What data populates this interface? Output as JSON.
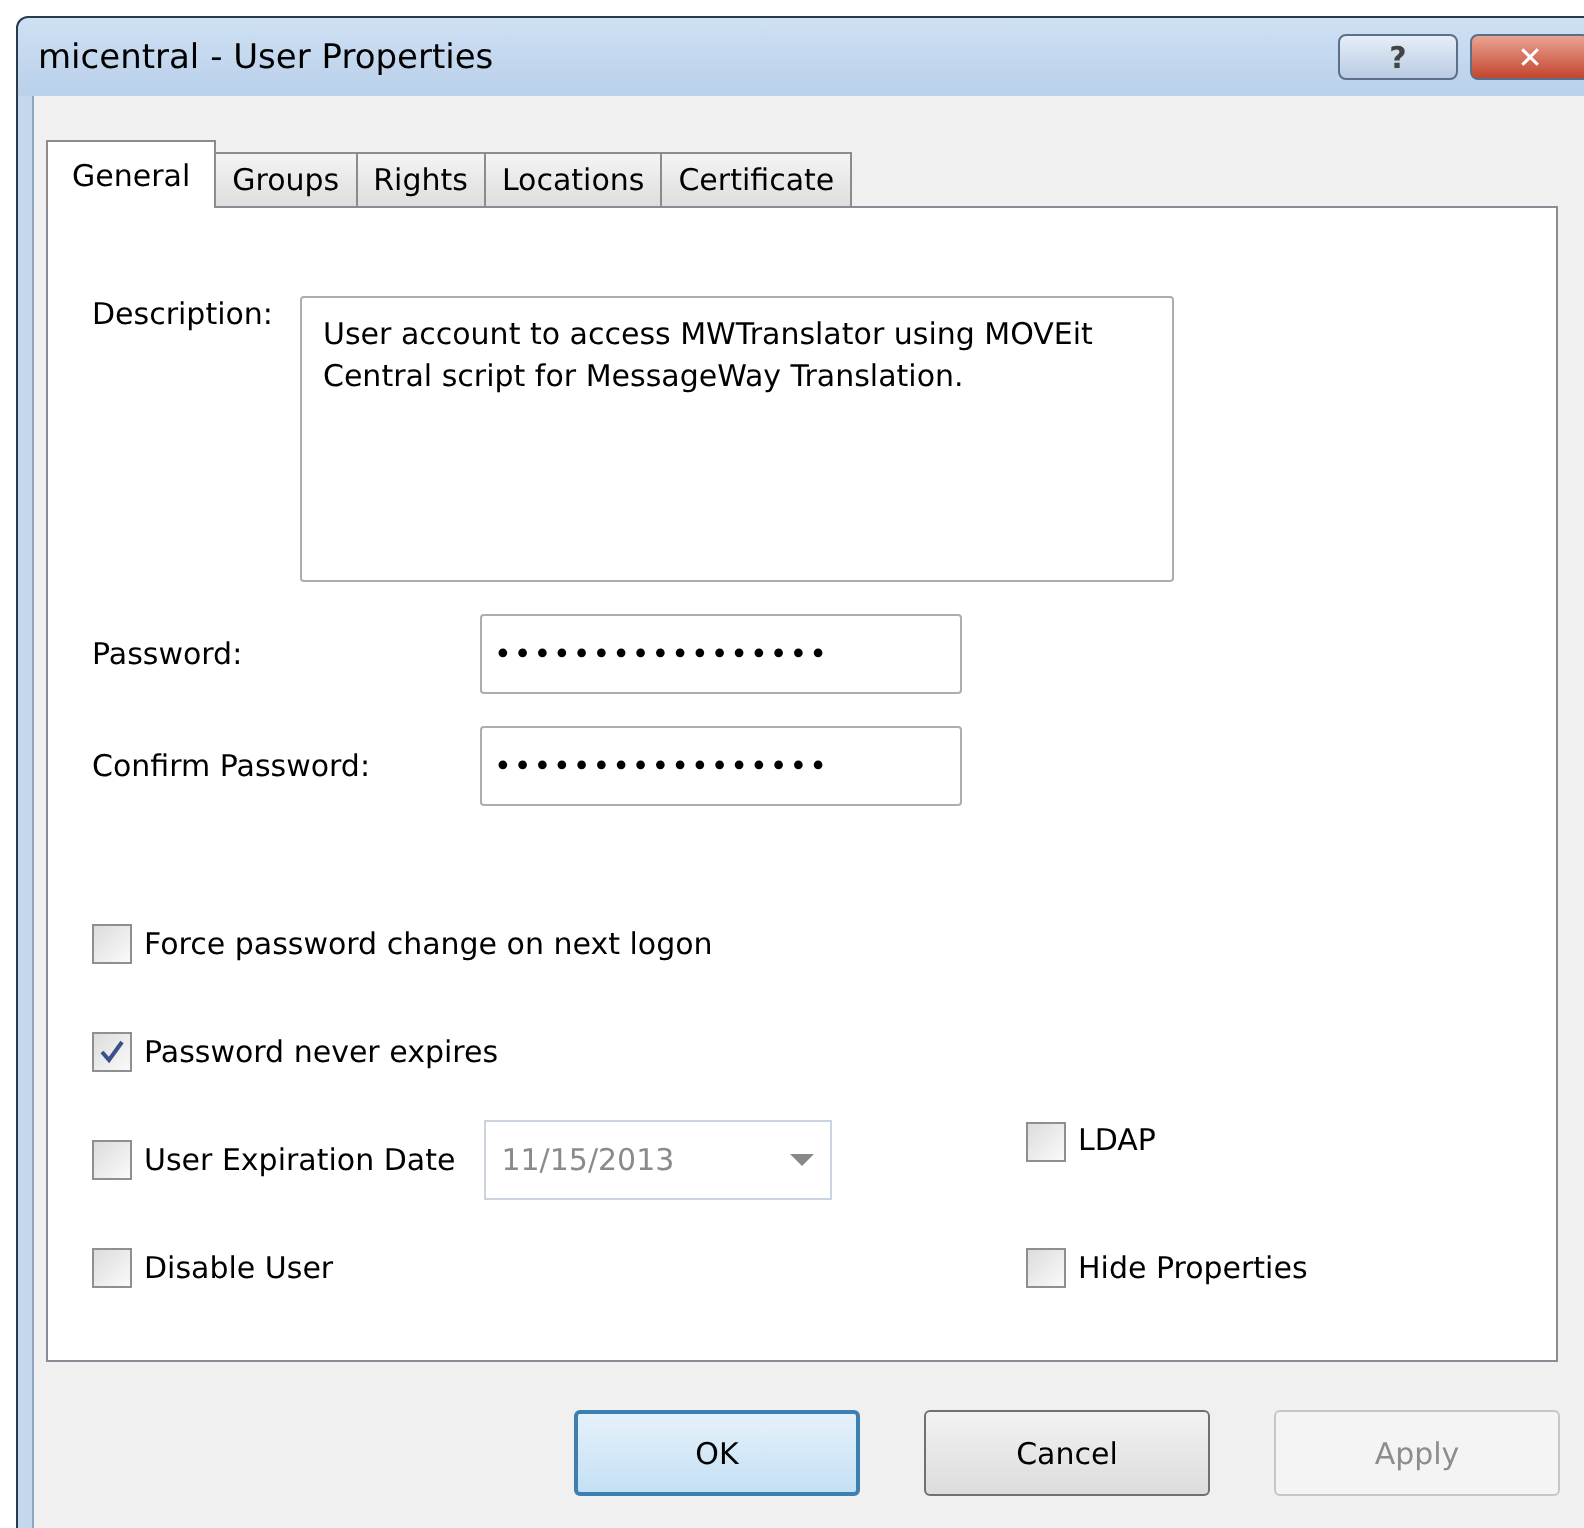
{
  "window": {
    "title": "micentral - User Properties",
    "help_button": "?",
    "close_button": "✕"
  },
  "tabs": [
    {
      "label": "General",
      "selected": true
    },
    {
      "label": "Groups",
      "selected": false
    },
    {
      "label": "Rights",
      "selected": false
    },
    {
      "label": "Locations",
      "selected": false
    },
    {
      "label": "Certificate",
      "selected": false
    }
  ],
  "description": {
    "label": "Description:",
    "value": "User account to access MWTranslator using MOVEit Central script for MessageWay Translation."
  },
  "password": {
    "label": "Password:",
    "value": "•••••••••••••••••"
  },
  "confirm_password": {
    "label": "Confirm Password:",
    "value": "•••••••••••••••••"
  },
  "force_change": {
    "label": "Force password change on next logon",
    "checked": false
  },
  "never_expires": {
    "label": "Password never expires",
    "checked": true
  },
  "expiration": {
    "label": "User Expiration Date",
    "checked": false,
    "date": "11/15/2013",
    "disabled": true
  },
  "disable_user": {
    "label": "Disable User",
    "checked": false
  },
  "ldap": {
    "label": "LDAP",
    "checked": false
  },
  "hide_properties": {
    "label": "Hide Properties",
    "checked": false
  },
  "buttons": [
    {
      "label": "OK",
      "kind": "default",
      "disabled": false
    },
    {
      "label": "Cancel",
      "kind": "normal",
      "disabled": false
    },
    {
      "label": "Apply",
      "kind": "normal",
      "disabled": true
    }
  ]
}
